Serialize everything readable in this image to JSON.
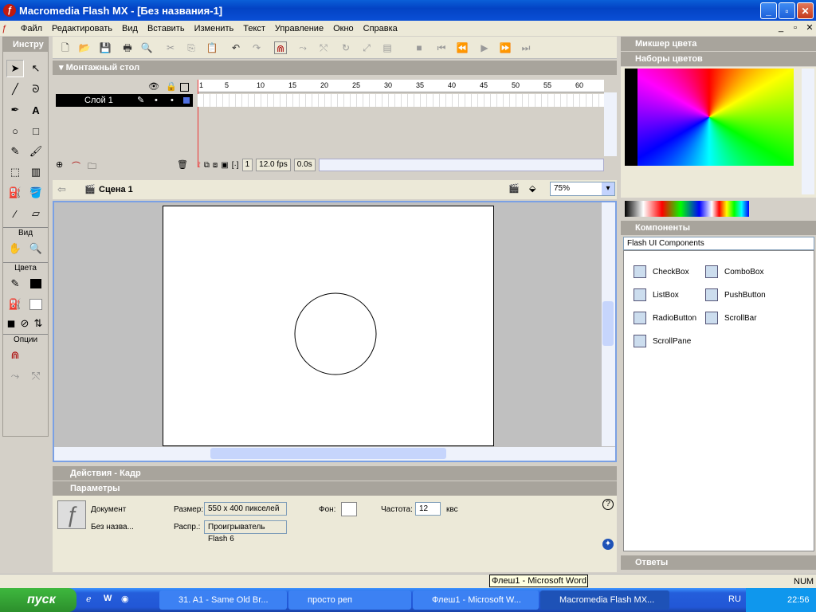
{
  "window": {
    "title": "Macromedia Flash MX - [Без названия-1]"
  },
  "menu": [
    "Файл",
    "Редактировать",
    "Вид",
    "Вставить",
    "Изменить",
    "Текст",
    "Управление",
    "Окно",
    "Справка"
  ],
  "tools": {
    "header": "Инстру",
    "view_label": "Вид",
    "colors_label": "Цвета",
    "options_label": "Опции"
  },
  "timeline": {
    "header": "Монтажный стол",
    "layer_name": "Слой 1",
    "ruler": [
      "1",
      "5",
      "10",
      "15",
      "20",
      "25",
      "30",
      "35",
      "40",
      "45",
      "50",
      "55",
      "60"
    ],
    "current_frame": "1",
    "fps": "12.0 fps",
    "time": "0.0s"
  },
  "scene": {
    "name": "Сцена 1",
    "zoom": "75%"
  },
  "panels": {
    "actions": "Действия - Кадр",
    "params": "Параметры"
  },
  "params": {
    "doc_label": "Документ",
    "doc_name": "Без назва...",
    "size_label": "Размер:",
    "size_value": "550 x 400 пикселей",
    "bg_label": "Фон:",
    "rate_label": "Частота:",
    "rate_value": "12",
    "rate_unit": "квс",
    "publish_label": "Распр.:",
    "publish_value": "Проигрыватель Flash 6"
  },
  "right": {
    "mixer": "Микшер цвета",
    "swatches": "Наборы цветов",
    "components": "Компоненты",
    "comp_set": "Flash UI Components",
    "items": [
      "CheckBox",
      "ComboBox",
      "ListBox",
      "PushButton",
      "RadioButton",
      "ScrollBar",
      "ScrollPane"
    ],
    "answers": "Ответы"
  },
  "tooltip": "Флеш1 - Microsoft Word",
  "status": {
    "num": "NUM"
  },
  "taskbar": {
    "start": "пуск",
    "tasks": [
      "31. A1 - Same Old Br...",
      "просто реп",
      "Флеш1 - Microsoft W...",
      "Macromedia Flash MX..."
    ],
    "lang": "RU",
    "clock": "22:56"
  }
}
